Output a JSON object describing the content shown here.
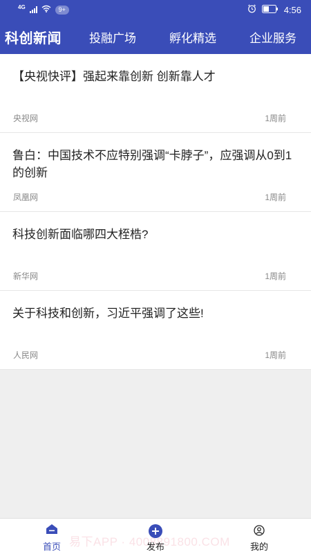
{
  "status_bar": {
    "network_type": "4G",
    "notification_badge": "9+",
    "time": "4:56"
  },
  "header": {
    "app_title": "科创新闻",
    "nav": [
      {
        "label": "投融广场"
      },
      {
        "label": "孵化精选"
      },
      {
        "label": "企业服务"
      }
    ]
  },
  "news": [
    {
      "title": "【央视快评】强起来靠创新 创新靠人才",
      "source": "央视网",
      "time": "1周前"
    },
    {
      "title": "鲁白：中国技术不应特别强调“卡脖子”，应强调从0到1的创新",
      "source": "凤凰网",
      "time": "1周前"
    },
    {
      "title": "科技创新面临哪四大桎梏?",
      "source": "新华网",
      "time": "1周前"
    },
    {
      "title": "关于科技和创新，习近平强调了这些!",
      "source": "人民网",
      "time": "1周前"
    }
  ],
  "bottom_nav": {
    "tabs": [
      {
        "label": "首页",
        "icon": "home-icon"
      },
      {
        "label": "发布",
        "icon": "plus-circle-icon"
      },
      {
        "label": "我的",
        "icon": "user-icon"
      }
    ],
    "active": "首页"
  },
  "watermark": "易下APP · 4008891800.COM",
  "colors": {
    "primary": "#3a4db8",
    "text": "#222222",
    "muted": "#888888",
    "background": "#efefef"
  }
}
